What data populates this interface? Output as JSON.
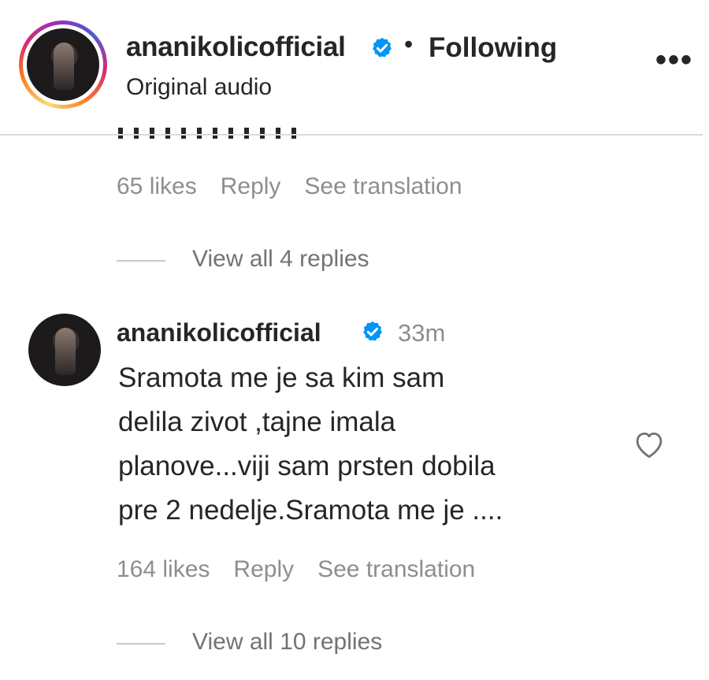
{
  "header": {
    "username": "ananikolicofficial",
    "separator": "•",
    "follow_status": "Following",
    "subtitle": "Original audio",
    "more_label": "•••"
  },
  "previous_comment": {
    "likes": "65 likes",
    "reply": "Reply",
    "translate": "See translation",
    "view_replies": "View all 4 replies"
  },
  "comment": {
    "username": "ananikolicofficial",
    "time": "33m",
    "lines": [
      "Sramota me je sa kim sam",
      "delila zivot ,tajne imala",
      "planove...viji sam prsten dobila",
      "pre 2 nedelje.Sramota me je ...."
    ],
    "likes": "164 likes",
    "reply": "Reply",
    "translate": "See translation",
    "view_replies": "View all 10 replies"
  },
  "colors": {
    "verified": "#0095f6",
    "meta_text": "#8e8e8e",
    "primary_text": "#262626"
  }
}
